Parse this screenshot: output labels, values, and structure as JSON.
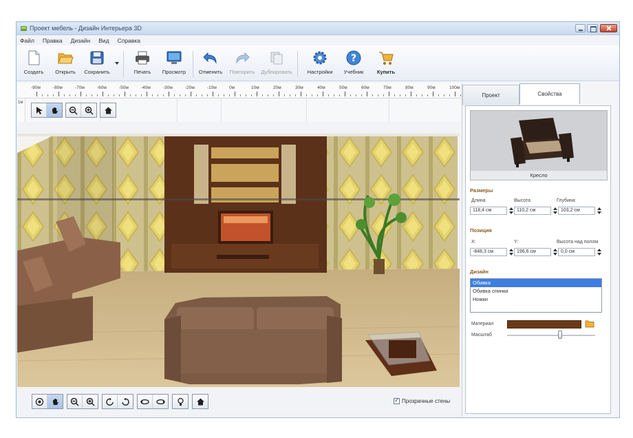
{
  "window": {
    "title": "Проект мебель - Дизайн Интерьера 3D"
  },
  "menu": [
    "Файл",
    "Правка",
    "Дизайн",
    "Вид",
    "Справка"
  ],
  "toolbar": {
    "buttons": [
      {
        "label": "Создать",
        "icon": "new-document-icon",
        "disabled": false
      },
      {
        "label": "Открыть",
        "icon": "folder-open-icon",
        "disabled": false
      },
      {
        "label": "Сохранить",
        "icon": "save-icon",
        "disabled": false
      },
      {
        "label": "Печать",
        "icon": "printer-icon",
        "disabled": false
      },
      {
        "label": "Просмотр",
        "icon": "monitor-icon",
        "disabled": false
      },
      {
        "label": "Отменить",
        "icon": "undo-icon",
        "disabled": false
      },
      {
        "label": "Повторить",
        "icon": "redo-icon",
        "disabled": true
      },
      {
        "label": "Дублировать",
        "icon": "duplicate-icon",
        "disabled": true
      },
      {
        "label": "Настройки",
        "icon": "gear-icon",
        "disabled": false
      },
      {
        "label": "Учебник",
        "icon": "help-icon",
        "disabled": false
      },
      {
        "label": "Купить",
        "icon": "cart-icon",
        "disabled": false
      }
    ]
  },
  "ruler": {
    "labels": [
      "-90м",
      "-80м",
      "-70м",
      "-60м",
      "-50м",
      "-40м",
      "-30м",
      "-20м",
      "-10м",
      "0м",
      "10м",
      "20м",
      "30м",
      "40м",
      "50м",
      "60м",
      "70м",
      "80м",
      "90м",
      "100м"
    ]
  },
  "vruler_label": "1м",
  "view_tools": [
    "select-arrow-icon",
    "hand-pan-icon",
    "zoom-out-icon",
    "zoom-in-icon",
    "home-icon"
  ],
  "bottom_tools": [
    "camera-icon",
    "hand-pan-icon",
    "zoom-out-icon",
    "zoom-in-icon",
    "rotate-left-icon",
    "rotate-right-icon",
    "orbit-left-icon",
    "orbit-right-icon",
    "light-icon",
    "home-icon"
  ],
  "transparent_walls": {
    "label": "Прозрачные стены",
    "checked": true
  },
  "tabs": [
    {
      "label": "Проект",
      "active": false
    },
    {
      "label": "Свойства",
      "active": true
    }
  ],
  "properties": {
    "preview_caption": "Кресло",
    "dimensions": {
      "title": "Размеры",
      "fields": [
        {
          "label": "Длина",
          "value": "118,4 см"
        },
        {
          "label": "Высота",
          "value": "110,2 см"
        },
        {
          "label": "Глубина",
          "value": "103,2 см"
        }
      ]
    },
    "position": {
      "title": "Позиция",
      "fields": [
        {
          "label": "X:",
          "value": "-848,3 см"
        },
        {
          "label": "Y:",
          "value": "196,6 см"
        },
        {
          "label": "Высота над полом",
          "value": "0,0 см"
        }
      ]
    },
    "design": {
      "title": "Дизайн",
      "items": [
        "Обивка",
        "Обивка спинки",
        "Ножки"
      ],
      "selected_index": 0,
      "material_label": "Материал",
      "texture_label": "Масштаб",
      "material_color": "#6a3a16",
      "texture_scale": 0.6
    }
  },
  "colors": {
    "accent": "#3d7fe0",
    "section_title": "#8a5a1e"
  }
}
